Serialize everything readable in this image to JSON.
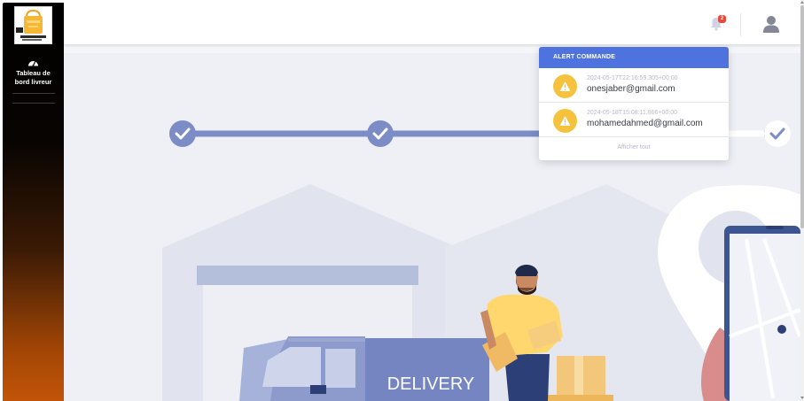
{
  "sidebar": {
    "logo_icon": "shopping-bag-logo",
    "items": [
      {
        "label_line1": "Tableau de",
        "label_line2": "bord livreur",
        "icon": "gauge-icon"
      }
    ]
  },
  "topbar": {
    "notification_count": "2",
    "bell_icon": "bell-icon",
    "user_icon": "user-icon"
  },
  "alerts": {
    "header": "ALERT COMMANDE",
    "items": [
      {
        "time": "2024-05-17T22:16:59.305+00:00",
        "email": "onesjaber@gmail.com",
        "icon": "warning-icon"
      },
      {
        "time": "2024-05-18T15:08:11.866+00:00",
        "email": "mohamedahmed@gmail.com",
        "icon": "warning-icon"
      }
    ],
    "footer": "Afficher tout"
  },
  "illustration": {
    "truck_text": "DELIVERY",
    "progress": {
      "steps_completed": 3,
      "steps_total": 3
    }
  },
  "colors": {
    "accent": "#4e73df",
    "warning": "#f6c23e",
    "badge": "#e74a3b",
    "sidebar_top": "#000000",
    "sidebar_bottom": "#c25408",
    "step": "#7b8cc6"
  }
}
